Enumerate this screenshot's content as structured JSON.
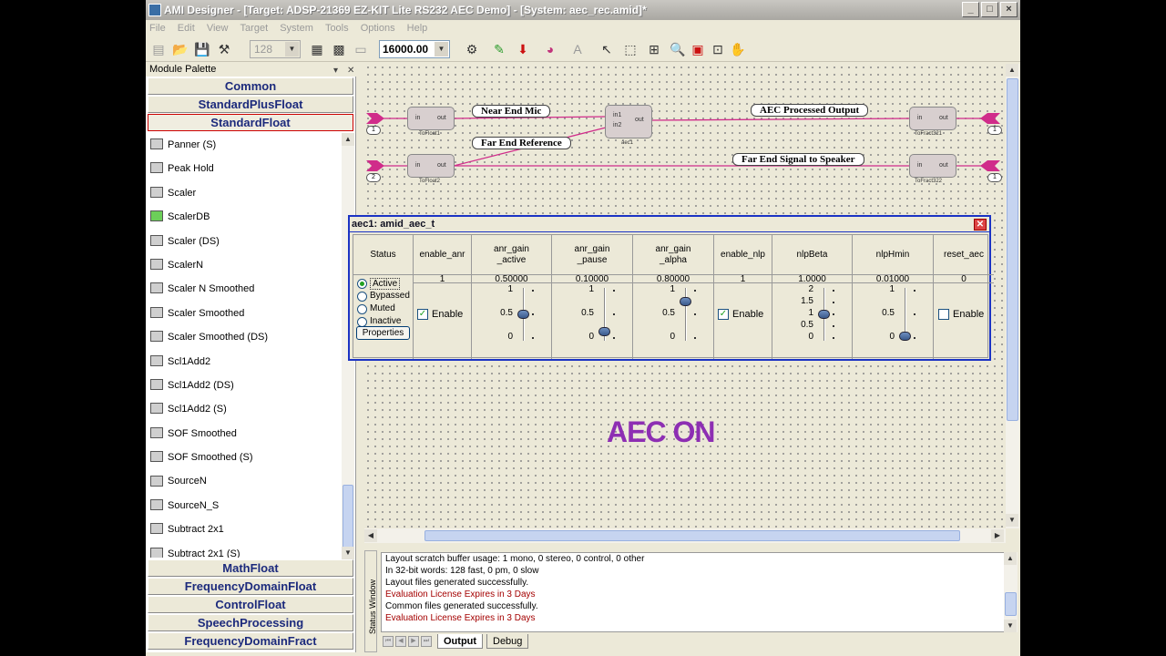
{
  "window": {
    "title": "AMI Designer - [Target: ADSP-21369 EZ-KIT Lite RS232 AEC Demo] - [System: aec_rec.amid]*"
  },
  "menu": [
    "File",
    "Edit",
    "View",
    "Target",
    "System",
    "Tools",
    "Options",
    "Help"
  ],
  "toolbar": {
    "zoom_value": "128",
    "sample_rate": "16000.00",
    "text_tool": "A"
  },
  "palette": {
    "title": "Module Palette",
    "categories_top": [
      "Common",
      "StandardPlusFloat",
      "StandardFloat"
    ],
    "selected_category": "StandardFloat",
    "items": [
      "Panner (S)",
      "Peak Hold",
      "Scaler",
      "ScalerDB",
      "Scaler (DS)",
      "ScalerN",
      "Scaler N Smoothed",
      "Scaler Smoothed",
      "Scaler Smoothed (DS)",
      "Scl1Add2",
      "Scl1Add2 (DS)",
      "Scl1Add2 (S)",
      "SOF Smoothed",
      "SOF Smoothed (S)",
      "SourceN",
      "SourceN_S",
      "Subtract 2x1",
      "Subtract 2x1 (S)"
    ],
    "categories_bottom": [
      "MathFloat",
      "FrequencyDomainFloat",
      "ControlFloat",
      "SpeechProcessing",
      "FrequencyDomainFract"
    ]
  },
  "canvas": {
    "labels": {
      "near_end": "Near End Mic",
      "far_end_ref": "Far End Reference",
      "aec_out": "AEC Processed Output",
      "far_end_spk": "Far End Signal to Speaker"
    },
    "modules": {
      "tofloat1": {
        "name": "ToFloat1",
        "in": "in",
        "out": "out"
      },
      "tofloat2": {
        "name": "ToFloat2",
        "in": "in",
        "out": "out"
      },
      "aec1": {
        "name": "aec1",
        "in1": "in1",
        "in2": "in2",
        "out": "out"
      },
      "tofract321": {
        "name": "ToFract321",
        "in": "in",
        "out": "out"
      },
      "tofract322": {
        "name": "ToFract322",
        "in": "in",
        "out": "out"
      }
    },
    "io_numbers": {
      "in1": "1",
      "in2": "2",
      "out1": "1",
      "out2": "1"
    },
    "overlay_text": "AEC ON"
  },
  "panel": {
    "title": "aec1: amid_aec_t",
    "status": {
      "header": "Status",
      "options": [
        "Active",
        "Bypassed",
        "Muted",
        "Inactive"
      ],
      "selected": "Active",
      "properties_label": "Properties"
    },
    "columns": [
      {
        "header": "enable_anr",
        "value": "1",
        "control": "checkbox",
        "checked": true,
        "label": "Enable"
      },
      {
        "header": "anr_gain\n_active",
        "value": "0.50000",
        "control": "slider",
        "ticks": [
          "1",
          "0.5",
          "0"
        ],
        "level": 0.5
      },
      {
        "header": "anr_gain\n_pause",
        "value": "0.10000",
        "control": "slider",
        "ticks": [
          "1",
          "0.5",
          "0"
        ],
        "level": 0.1
      },
      {
        "header": "anr_gain\n_alpha",
        "value": "0.80000",
        "control": "slider",
        "ticks": [
          "1",
          "0.5",
          "0"
        ],
        "level": 0.8
      },
      {
        "header": "enable_nlp",
        "value": "1",
        "control": "checkbox",
        "checked": true,
        "label": "Enable"
      },
      {
        "header": "nlpBeta",
        "value": "1.0000",
        "control": "slider",
        "ticks": [
          "2",
          "1.5",
          "1",
          "0.5",
          "0"
        ],
        "level": 0.5
      },
      {
        "header": "nlpHmin",
        "value": "0.01000",
        "control": "slider",
        "ticks": [
          "1",
          "0.5",
          "0"
        ],
        "level": 0.01
      },
      {
        "header": "reset_aec",
        "value": "0",
        "control": "checkbox",
        "checked": false,
        "label": "Enable"
      }
    ]
  },
  "status_window": {
    "title": "Status Window",
    "lines": [
      {
        "text": "Layout scratch buffer usage: 1 mono, 0 stereo, 0 control, 0 other",
        "warn": false
      },
      {
        "text": "In 32-bit words: 128 fast, 0 pm, 0 slow",
        "warn": false
      },
      {
        "text": "Layout files generated successfully.",
        "warn": false
      },
      {
        "text": "Evaluation License Expires in 3 Days",
        "warn": true
      },
      {
        "text": "Common files generated successfully.",
        "warn": false
      },
      {
        "text": "Evaluation License Expires in 3 Days",
        "warn": true
      }
    ],
    "tabs": [
      "Output",
      "Debug"
    ],
    "active_tab": "Output"
  },
  "colors": {
    "wire": "#d02c8a",
    "overlay": "#8d2eb3",
    "category_text": "#1c2a7c",
    "panel_border": "#1b33c4"
  }
}
